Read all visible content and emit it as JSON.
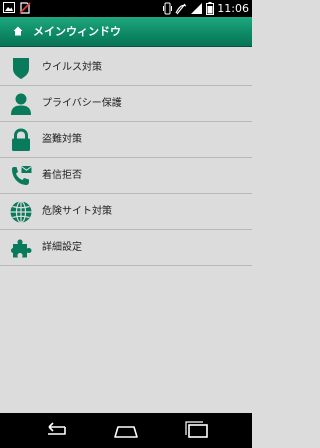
{
  "status_bar": {
    "time": "11:06",
    "icons": [
      "picture-icon",
      "no-sim-icon",
      "vibrate-icon",
      "no-signal-icon",
      "signal-icon",
      "battery-icon"
    ]
  },
  "header": {
    "title": "メインウィンドウ",
    "icon": "home-icon"
  },
  "menu": {
    "items": [
      {
        "label": "ウイルス対策",
        "icon": "shield-icon"
      },
      {
        "label": "プライバシー保護",
        "icon": "person-icon"
      },
      {
        "label": "盗難対策",
        "icon": "lock-icon"
      },
      {
        "label": "着信拒否",
        "icon": "phone-mail-icon"
      },
      {
        "label": "危険サイト対策",
        "icon": "globe-icon"
      },
      {
        "label": "詳細設定",
        "icon": "puzzle-icon"
      }
    ]
  },
  "nav_bar": {
    "buttons": [
      "back-icon",
      "home-icon",
      "recents-icon"
    ]
  },
  "colors": {
    "accent": "#0d8a66",
    "icon": "#0a7a5c",
    "background": "#dcdcdc"
  }
}
